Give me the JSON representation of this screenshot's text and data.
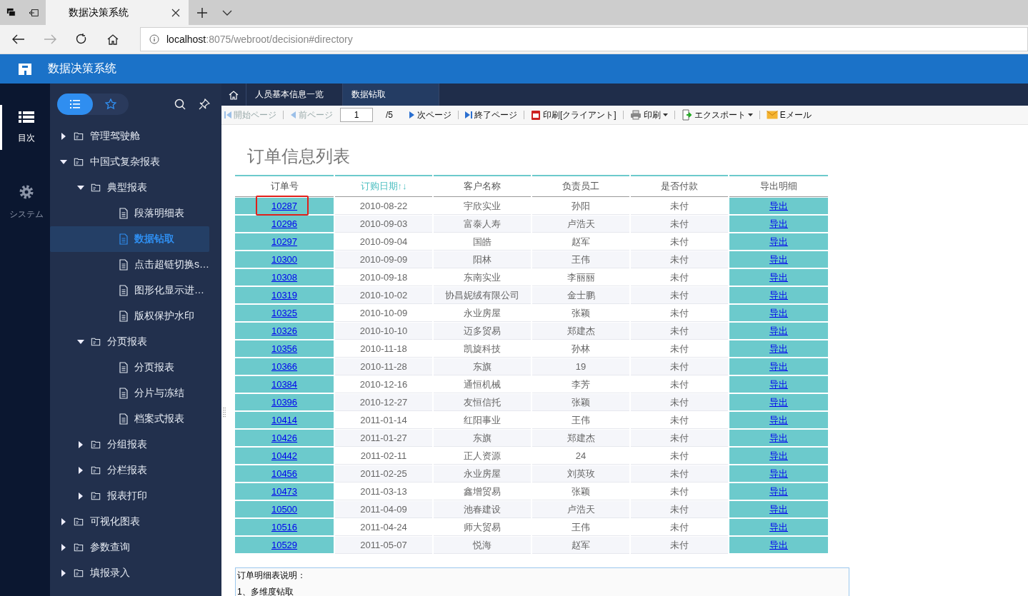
{
  "browser": {
    "tab_title": "数据决策系统",
    "url_host": "localhost",
    "url_path": ":8075/webroot/decision#directory"
  },
  "app": {
    "title": "数据决策系统"
  },
  "rail": [
    {
      "label": "目次",
      "selected": true
    },
    {
      "label": "システム",
      "selected": false
    }
  ],
  "panel_tabs": [
    {
      "selected": true
    },
    {
      "selected": false
    }
  ],
  "tree": [
    {
      "label": "管理驾驶舱",
      "expanded": false,
      "selected": false
    },
    {
      "label": "中国式复杂报表",
      "expanded": true,
      "selected": false,
      "children": [
        {
          "label": "典型报表",
          "expanded": true,
          "selected": false,
          "children": [
            {
              "label": "段落明细表",
              "selected": false
            },
            {
              "label": "数据钻取",
              "selected": true
            },
            {
              "label": "点击超链切换s…",
              "selected": false
            },
            {
              "label": "图形化显示进…",
              "selected": false
            },
            {
              "label": "版权保护水印",
              "selected": false
            }
          ]
        },
        {
          "label": "分页报表",
          "expanded": true,
          "selected": false,
          "children": [
            {
              "label": "分页报表",
              "selected": false
            },
            {
              "label": "分片与冻结",
              "selected": false
            },
            {
              "label": "档案式报表",
              "selected": false
            }
          ]
        },
        {
          "label": "分组报表",
          "expanded": false,
          "selected": false
        },
        {
          "label": "分栏报表",
          "expanded": false,
          "selected": false
        },
        {
          "label": "报表打印",
          "expanded": false,
          "selected": false
        }
      ]
    },
    {
      "label": "可视化图表",
      "expanded": false,
      "selected": false
    },
    {
      "label": "参数查询",
      "expanded": false,
      "selected": false
    },
    {
      "label": "填报录入",
      "expanded": false,
      "selected": false
    }
  ],
  "tabs": [
    {
      "label": "人员基本信息一览",
      "selected": false
    },
    {
      "label": "数据钻取",
      "selected": true
    }
  ],
  "toolbar": [
    {
      "kind": "first",
      "label": "開始ページ",
      "disabled": true
    },
    {
      "kind": "prev",
      "label": "前ページ",
      "disabled": true
    },
    {
      "kind": "page",
      "value": "1",
      "total": "/5"
    },
    {
      "kind": "next",
      "label": "次ページ",
      "disabled": false
    },
    {
      "kind": "last",
      "label": "終了ページ",
      "disabled": false
    },
    {
      "kind": "flprint",
      "label": "印刷[クライアント]",
      "disabled": false
    },
    {
      "kind": "print",
      "label": "印刷",
      "disabled": false,
      "dropdown": true
    },
    {
      "kind": "export",
      "label": "エクスポート",
      "disabled": false,
      "dropdown": true
    },
    {
      "kind": "mail",
      "label": "Eメール",
      "disabled": false
    }
  ],
  "report": {
    "title": "订单信息列表",
    "columns": [
      {
        "label": "订单号",
        "sorted": false
      },
      {
        "label": "订购日期↑↓",
        "sorted": true
      },
      {
        "label": "客户名称",
        "sorted": false
      },
      {
        "label": "负责员工",
        "sorted": false
      },
      {
        "label": "是否付款",
        "sorted": false
      },
      {
        "label": "导出明细",
        "sorted": false
      }
    ],
    "rows": [
      {
        "order": "10287",
        "date": "2010-08-22",
        "customer": "宇欣实业",
        "staff": "孙阳",
        "paid": "未付",
        "export": "导出",
        "highlighted": true
      },
      {
        "order": "10296",
        "date": "2010-09-03",
        "customer": "富泰人寿",
        "staff": "卢浩天",
        "paid": "未付",
        "export": "导出",
        "highlighted": false
      },
      {
        "order": "10297",
        "date": "2010-09-04",
        "customer": "国皓",
        "staff": "赵军",
        "paid": "未付",
        "export": "导出",
        "highlighted": false
      },
      {
        "order": "10300",
        "date": "2010-09-09",
        "customer": "阳林",
        "staff": "王伟",
        "paid": "未付",
        "export": "导出",
        "highlighted": false
      },
      {
        "order": "10308",
        "date": "2010-09-18",
        "customer": "东南实业",
        "staff": "李丽丽",
        "paid": "未付",
        "export": "导出",
        "highlighted": false
      },
      {
        "order": "10319",
        "date": "2010-10-02",
        "customer": "协昌妮绒有限公司",
        "staff": "金士鹏",
        "paid": "未付",
        "export": "导出",
        "highlighted": false
      },
      {
        "order": "10325",
        "date": "2010-10-09",
        "customer": "永业房屋",
        "staff": "张颖",
        "paid": "未付",
        "export": "导出",
        "highlighted": false
      },
      {
        "order": "10326",
        "date": "2010-10-10",
        "customer": "迈多贸易",
        "staff": "郑建杰",
        "paid": "未付",
        "export": "导出",
        "highlighted": false
      },
      {
        "order": "10356",
        "date": "2010-11-18",
        "customer": "凯旋科技",
        "staff": "孙林",
        "paid": "未付",
        "export": "导出",
        "highlighted": false
      },
      {
        "order": "10366",
        "date": "2010-11-28",
        "customer": "东旗",
        "staff": "19",
        "paid": "未付",
        "export": "导出",
        "highlighted": false
      },
      {
        "order": "10384",
        "date": "2010-12-16",
        "customer": "通恒机械",
        "staff": "李芳",
        "paid": "未付",
        "export": "导出",
        "highlighted": false
      },
      {
        "order": "10396",
        "date": "2010-12-27",
        "customer": "友恒信托",
        "staff": "张颖",
        "paid": "未付",
        "export": "导出",
        "highlighted": false
      },
      {
        "order": "10414",
        "date": "2011-01-14",
        "customer": "红阳事业",
        "staff": "王伟",
        "paid": "未付",
        "export": "导出",
        "highlighted": false
      },
      {
        "order": "10426",
        "date": "2011-01-27",
        "customer": "东旗",
        "staff": "郑建杰",
        "paid": "未付",
        "export": "导出",
        "highlighted": false
      },
      {
        "order": "10442",
        "date": "2011-02-11",
        "customer": "正人资源",
        "staff": "24",
        "paid": "未付",
        "export": "导出",
        "highlighted": false
      },
      {
        "order": "10456",
        "date": "2011-02-25",
        "customer": "永业房屋",
        "staff": "刘英玫",
        "paid": "未付",
        "export": "导出",
        "highlighted": false
      },
      {
        "order": "10473",
        "date": "2011-03-13",
        "customer": "鑫增贸易",
        "staff": "张颖",
        "paid": "未付",
        "export": "导出",
        "highlighted": false
      },
      {
        "order": "10500",
        "date": "2011-04-09",
        "customer": "池春建设",
        "staff": "卢浩天",
        "paid": "未付",
        "export": "导出",
        "highlighted": false
      },
      {
        "order": "10516",
        "date": "2011-04-24",
        "customer": "师大贸易",
        "staff": "王伟",
        "paid": "未付",
        "export": "导出",
        "highlighted": false
      },
      {
        "order": "10529",
        "date": "2011-05-07",
        "customer": "悦海",
        "staff": "赵军",
        "paid": "未付",
        "export": "导出",
        "highlighted": false
      }
    ],
    "note": [
      "订单明细表说明：",
      "1、多维度钻取"
    ]
  }
}
